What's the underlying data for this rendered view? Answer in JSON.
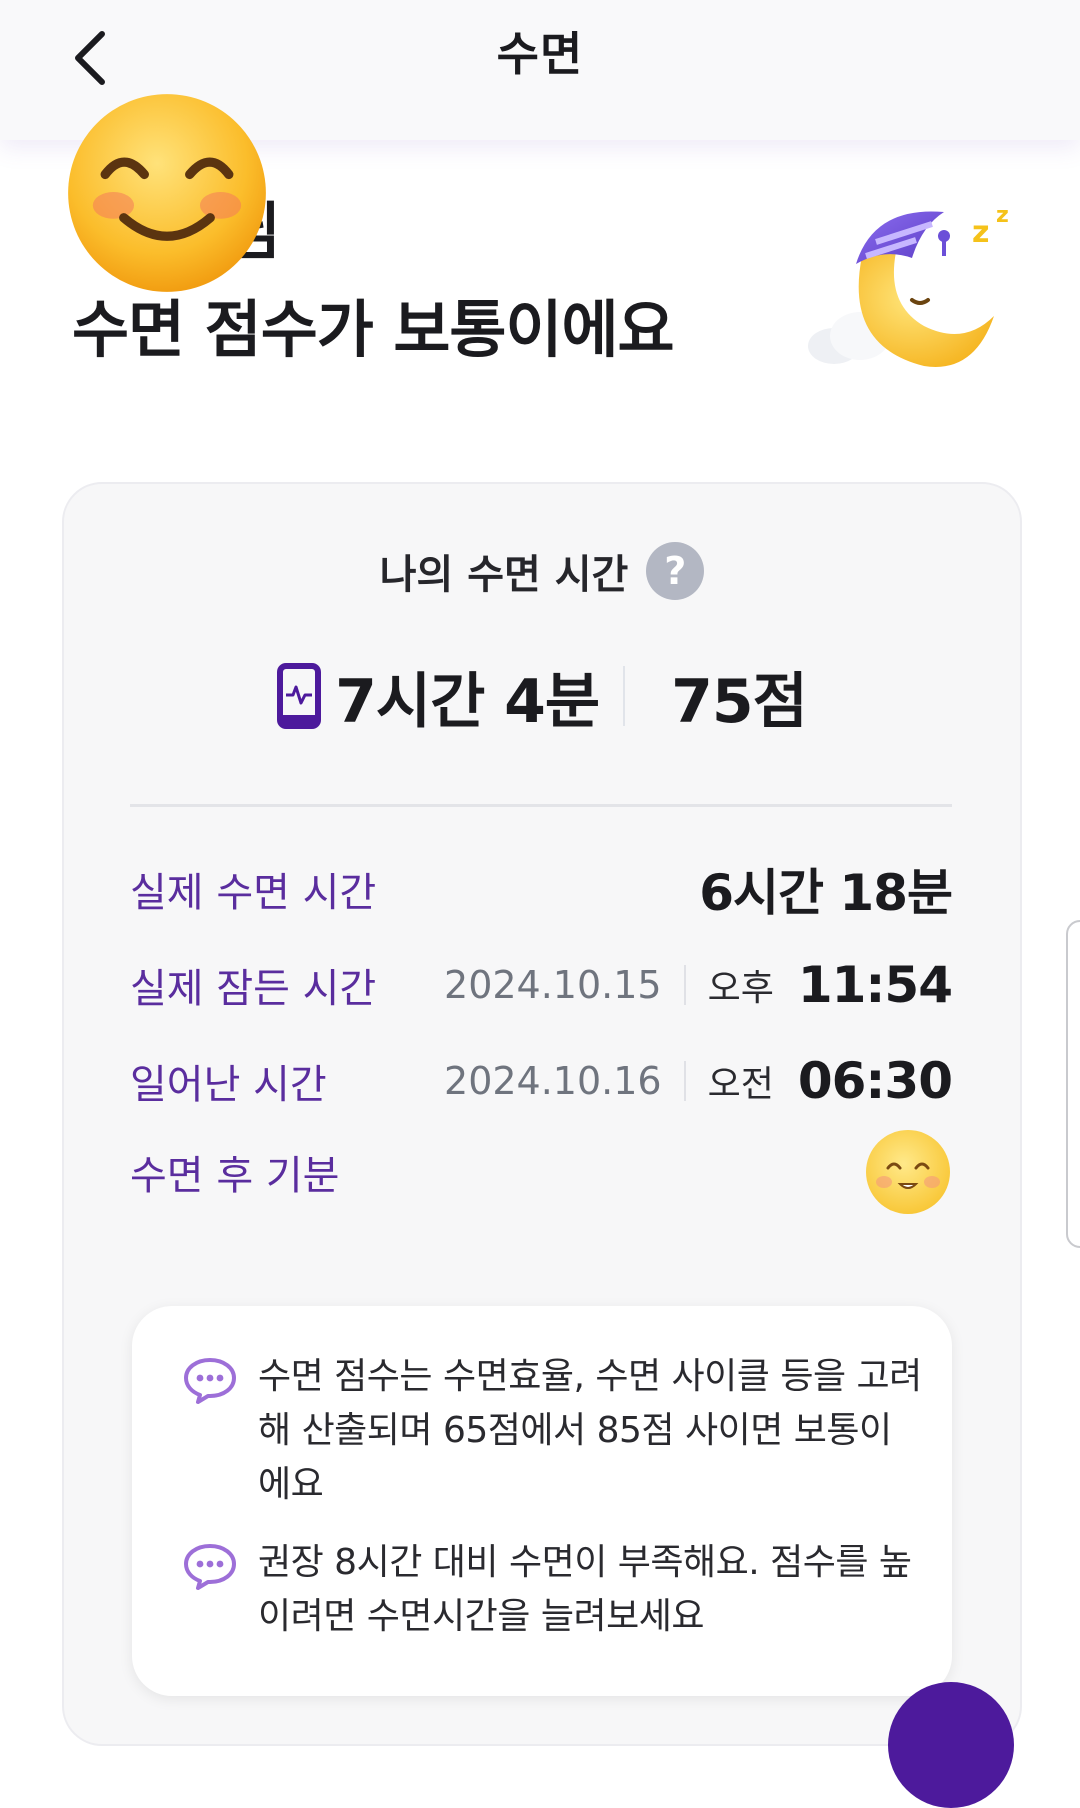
{
  "header": {
    "title": "수면",
    "back_icon": "chevron-left-icon"
  },
  "greeting": {
    "name_suffix": "님",
    "status": "수면 점수가 보통이에요",
    "avatar_icon": "smiling-face-emoji",
    "illustration_icon": "sleeping-moon-icon"
  },
  "card": {
    "heading": "나의 수면 시간",
    "help_symbol": "?",
    "duration": "7시간 4분",
    "duration_icon": "phone-heartbeat-icon",
    "score": "75점",
    "rows": {
      "actual_sleep": {
        "label": "실제 수면 시간",
        "value": "6시간 18분"
      },
      "fell_asleep": {
        "label": "실제 잠든 시간",
        "date": "2024.10.15",
        "ampm": "오후",
        "time": "11:54"
      },
      "woke_up": {
        "label": "일어난 시간",
        "date": "2024.10.16",
        "ampm": "오전",
        "time": "06:30"
      },
      "mood": {
        "label": "수면 후 기분",
        "icon": "smiling-mood-icon"
      }
    },
    "info": [
      {
        "icon": "chat-bubble-icon",
        "text": "수면 점수는 수면효율, 수면 사이클 등을 고려해 산출되며 65점에서 85점 사이면 보통이에요"
      },
      {
        "icon": "chat-bubble-icon",
        "text": "권장 8시간 대비 수면이 부족해요. 점수를 높이려면 수면시간을 늘려보세요"
      }
    ]
  },
  "colors": {
    "accent": "#4d1a9c",
    "label": "#5a2d9e",
    "background": "#ffffff",
    "card": "#f7f7f8"
  }
}
